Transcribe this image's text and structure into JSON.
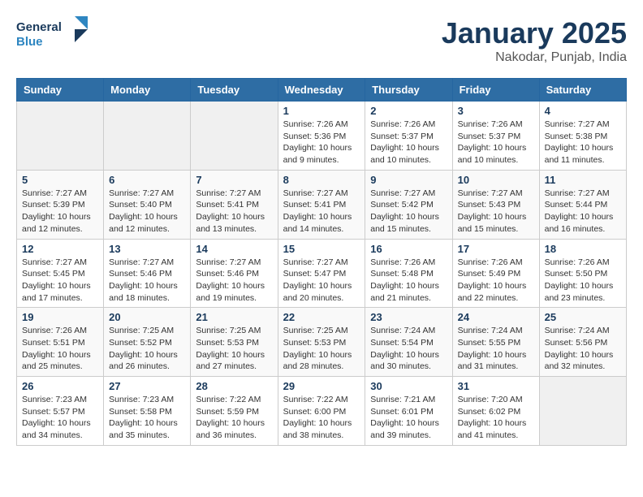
{
  "logo": {
    "line1": "General",
    "line2": "Blue"
  },
  "title": "January 2025",
  "location": "Nakodar, Punjab, India",
  "days_of_week": [
    "Sunday",
    "Monday",
    "Tuesday",
    "Wednesday",
    "Thursday",
    "Friday",
    "Saturday"
  ],
  "weeks": [
    [
      {
        "day": "",
        "info": ""
      },
      {
        "day": "",
        "info": ""
      },
      {
        "day": "",
        "info": ""
      },
      {
        "day": "1",
        "info": "Sunrise: 7:26 AM\nSunset: 5:36 PM\nDaylight: 10 hours\nand 9 minutes."
      },
      {
        "day": "2",
        "info": "Sunrise: 7:26 AM\nSunset: 5:37 PM\nDaylight: 10 hours\nand 10 minutes."
      },
      {
        "day": "3",
        "info": "Sunrise: 7:26 AM\nSunset: 5:37 PM\nDaylight: 10 hours\nand 10 minutes."
      },
      {
        "day": "4",
        "info": "Sunrise: 7:27 AM\nSunset: 5:38 PM\nDaylight: 10 hours\nand 11 minutes."
      }
    ],
    [
      {
        "day": "5",
        "info": "Sunrise: 7:27 AM\nSunset: 5:39 PM\nDaylight: 10 hours\nand 12 minutes."
      },
      {
        "day": "6",
        "info": "Sunrise: 7:27 AM\nSunset: 5:40 PM\nDaylight: 10 hours\nand 12 minutes."
      },
      {
        "day": "7",
        "info": "Sunrise: 7:27 AM\nSunset: 5:41 PM\nDaylight: 10 hours\nand 13 minutes."
      },
      {
        "day": "8",
        "info": "Sunrise: 7:27 AM\nSunset: 5:41 PM\nDaylight: 10 hours\nand 14 minutes."
      },
      {
        "day": "9",
        "info": "Sunrise: 7:27 AM\nSunset: 5:42 PM\nDaylight: 10 hours\nand 15 minutes."
      },
      {
        "day": "10",
        "info": "Sunrise: 7:27 AM\nSunset: 5:43 PM\nDaylight: 10 hours\nand 15 minutes."
      },
      {
        "day": "11",
        "info": "Sunrise: 7:27 AM\nSunset: 5:44 PM\nDaylight: 10 hours\nand 16 minutes."
      }
    ],
    [
      {
        "day": "12",
        "info": "Sunrise: 7:27 AM\nSunset: 5:45 PM\nDaylight: 10 hours\nand 17 minutes."
      },
      {
        "day": "13",
        "info": "Sunrise: 7:27 AM\nSunset: 5:46 PM\nDaylight: 10 hours\nand 18 minutes."
      },
      {
        "day": "14",
        "info": "Sunrise: 7:27 AM\nSunset: 5:46 PM\nDaylight: 10 hours\nand 19 minutes."
      },
      {
        "day": "15",
        "info": "Sunrise: 7:27 AM\nSunset: 5:47 PM\nDaylight: 10 hours\nand 20 minutes."
      },
      {
        "day": "16",
        "info": "Sunrise: 7:26 AM\nSunset: 5:48 PM\nDaylight: 10 hours\nand 21 minutes."
      },
      {
        "day": "17",
        "info": "Sunrise: 7:26 AM\nSunset: 5:49 PM\nDaylight: 10 hours\nand 22 minutes."
      },
      {
        "day": "18",
        "info": "Sunrise: 7:26 AM\nSunset: 5:50 PM\nDaylight: 10 hours\nand 23 minutes."
      }
    ],
    [
      {
        "day": "19",
        "info": "Sunrise: 7:26 AM\nSunset: 5:51 PM\nDaylight: 10 hours\nand 25 minutes."
      },
      {
        "day": "20",
        "info": "Sunrise: 7:25 AM\nSunset: 5:52 PM\nDaylight: 10 hours\nand 26 minutes."
      },
      {
        "day": "21",
        "info": "Sunrise: 7:25 AM\nSunset: 5:53 PM\nDaylight: 10 hours\nand 27 minutes."
      },
      {
        "day": "22",
        "info": "Sunrise: 7:25 AM\nSunset: 5:53 PM\nDaylight: 10 hours\nand 28 minutes."
      },
      {
        "day": "23",
        "info": "Sunrise: 7:24 AM\nSunset: 5:54 PM\nDaylight: 10 hours\nand 30 minutes."
      },
      {
        "day": "24",
        "info": "Sunrise: 7:24 AM\nSunset: 5:55 PM\nDaylight: 10 hours\nand 31 minutes."
      },
      {
        "day": "25",
        "info": "Sunrise: 7:24 AM\nSunset: 5:56 PM\nDaylight: 10 hours\nand 32 minutes."
      }
    ],
    [
      {
        "day": "26",
        "info": "Sunrise: 7:23 AM\nSunset: 5:57 PM\nDaylight: 10 hours\nand 34 minutes."
      },
      {
        "day": "27",
        "info": "Sunrise: 7:23 AM\nSunset: 5:58 PM\nDaylight: 10 hours\nand 35 minutes."
      },
      {
        "day": "28",
        "info": "Sunrise: 7:22 AM\nSunset: 5:59 PM\nDaylight: 10 hours\nand 36 minutes."
      },
      {
        "day": "29",
        "info": "Sunrise: 7:22 AM\nSunset: 6:00 PM\nDaylight: 10 hours\nand 38 minutes."
      },
      {
        "day": "30",
        "info": "Sunrise: 7:21 AM\nSunset: 6:01 PM\nDaylight: 10 hours\nand 39 minutes."
      },
      {
        "day": "31",
        "info": "Sunrise: 7:20 AM\nSunset: 6:02 PM\nDaylight: 10 hours\nand 41 minutes."
      },
      {
        "day": "",
        "info": ""
      }
    ]
  ]
}
